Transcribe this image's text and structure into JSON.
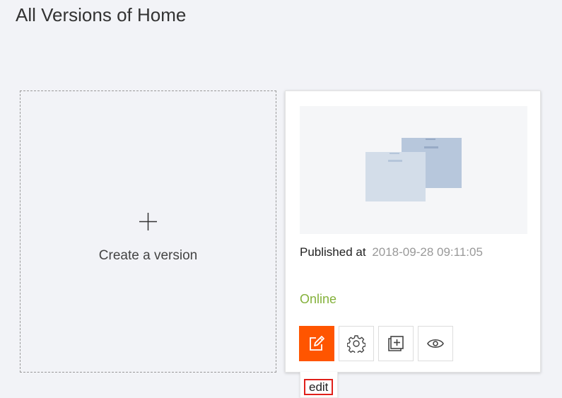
{
  "page": {
    "title": "All Versions of Home"
  },
  "create_card": {
    "label": "Create a version",
    "icon": "plus-icon"
  },
  "version_card": {
    "thumbnail_icon": "document-stack-icon",
    "published_label": "Published at",
    "published_date": "2018-09-28 09:11:05",
    "status": "Online",
    "status_color": "#84b13b",
    "actions": [
      {
        "name": "edit",
        "icon": "edit-icon",
        "active": true
      },
      {
        "name": "settings",
        "icon": "gear-icon",
        "active": false
      },
      {
        "name": "copy",
        "icon": "duplicate-icon",
        "active": false
      },
      {
        "name": "preview",
        "icon": "eye-icon",
        "active": false
      }
    ]
  },
  "tooltip": {
    "label": "edit"
  },
  "colors": {
    "accent": "#ff5500",
    "background": "#f2f3f7"
  }
}
